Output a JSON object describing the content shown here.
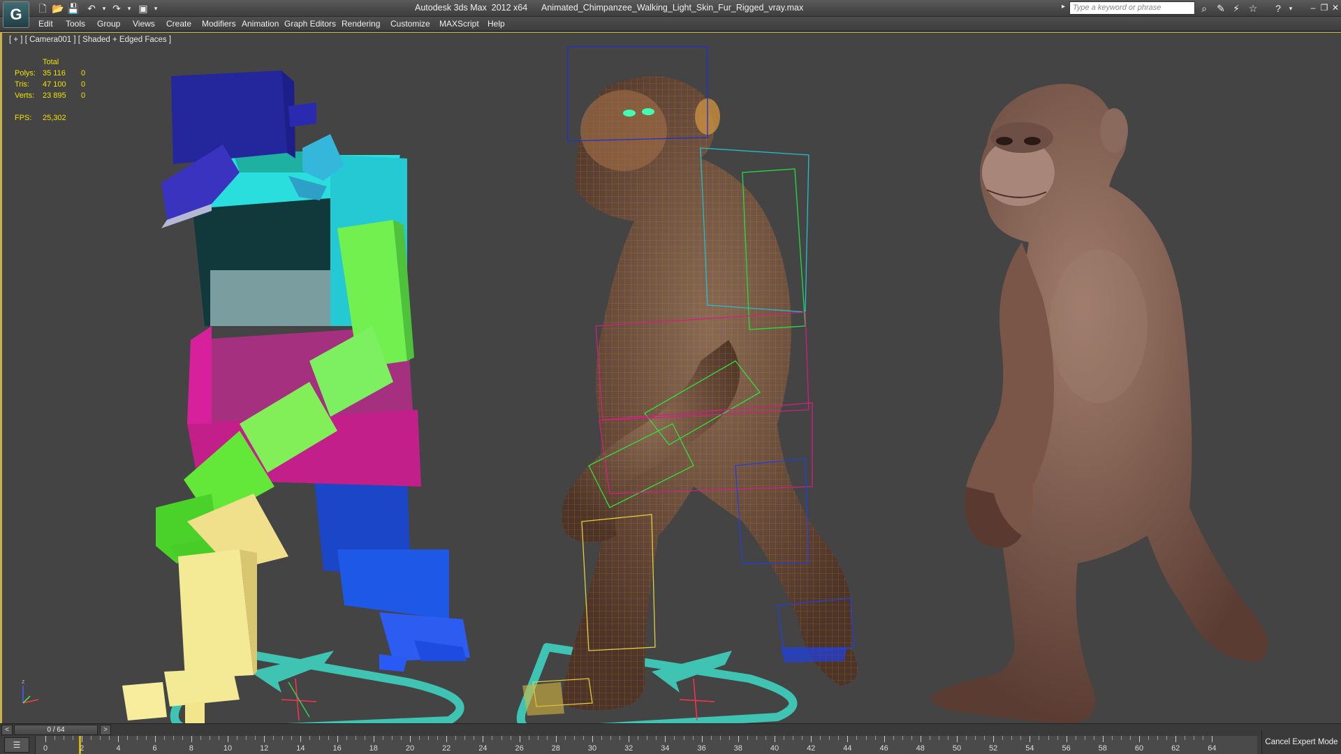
{
  "titlebar": {
    "app_title": "Autodesk 3ds Max  2012 x64",
    "file_name": "Animated_Chimpanzee_Walking_Light_Skin_Fur_Rigged_vray.max",
    "logo_text": "G",
    "search_placeholder": "Type a keyword or phrase"
  },
  "menu": {
    "items": [
      "Edit",
      "Tools",
      "Group",
      "Views",
      "Create",
      "Modifiers",
      "Animation",
      "Graph Editors",
      "Rendering",
      "Customize",
      "MAXScript",
      "Help"
    ]
  },
  "viewport": {
    "label": "[ + ] [ Camera001 ] [ Shaded + Edged Faces ]",
    "stats": {
      "header": "Total",
      "polys_label": "Polys:",
      "polys_total": "35 116",
      "polys_sel": "0",
      "tris_label": "Tris:",
      "tris_total": "47 100",
      "tris_sel": "0",
      "verts_label": "Verts:",
      "verts_total": "23 895",
      "verts_sel": "0",
      "fps_label": "FPS:",
      "fps_value": "25,302"
    }
  },
  "timeslider": {
    "frame_display": "0 / 64",
    "prev": "<",
    "next": ">"
  },
  "trackbar": {
    "ticks": [
      "0",
      "2",
      "4",
      "6",
      "8",
      "10",
      "12",
      "14",
      "16",
      "18",
      "20",
      "22",
      "24",
      "26",
      "28",
      "30",
      "32",
      "34",
      "36",
      "38",
      "40",
      "42",
      "44",
      "46",
      "48",
      "50",
      "52",
      "54",
      "56",
      "58",
      "60",
      "62",
      "64"
    ]
  },
  "status": {
    "cancel_expert_mode": "Cancel Expert Mode"
  },
  "colors": {
    "viewport_bg": "#444444",
    "active_border": "#c9b14a",
    "stats_text": "#f2e200"
  }
}
